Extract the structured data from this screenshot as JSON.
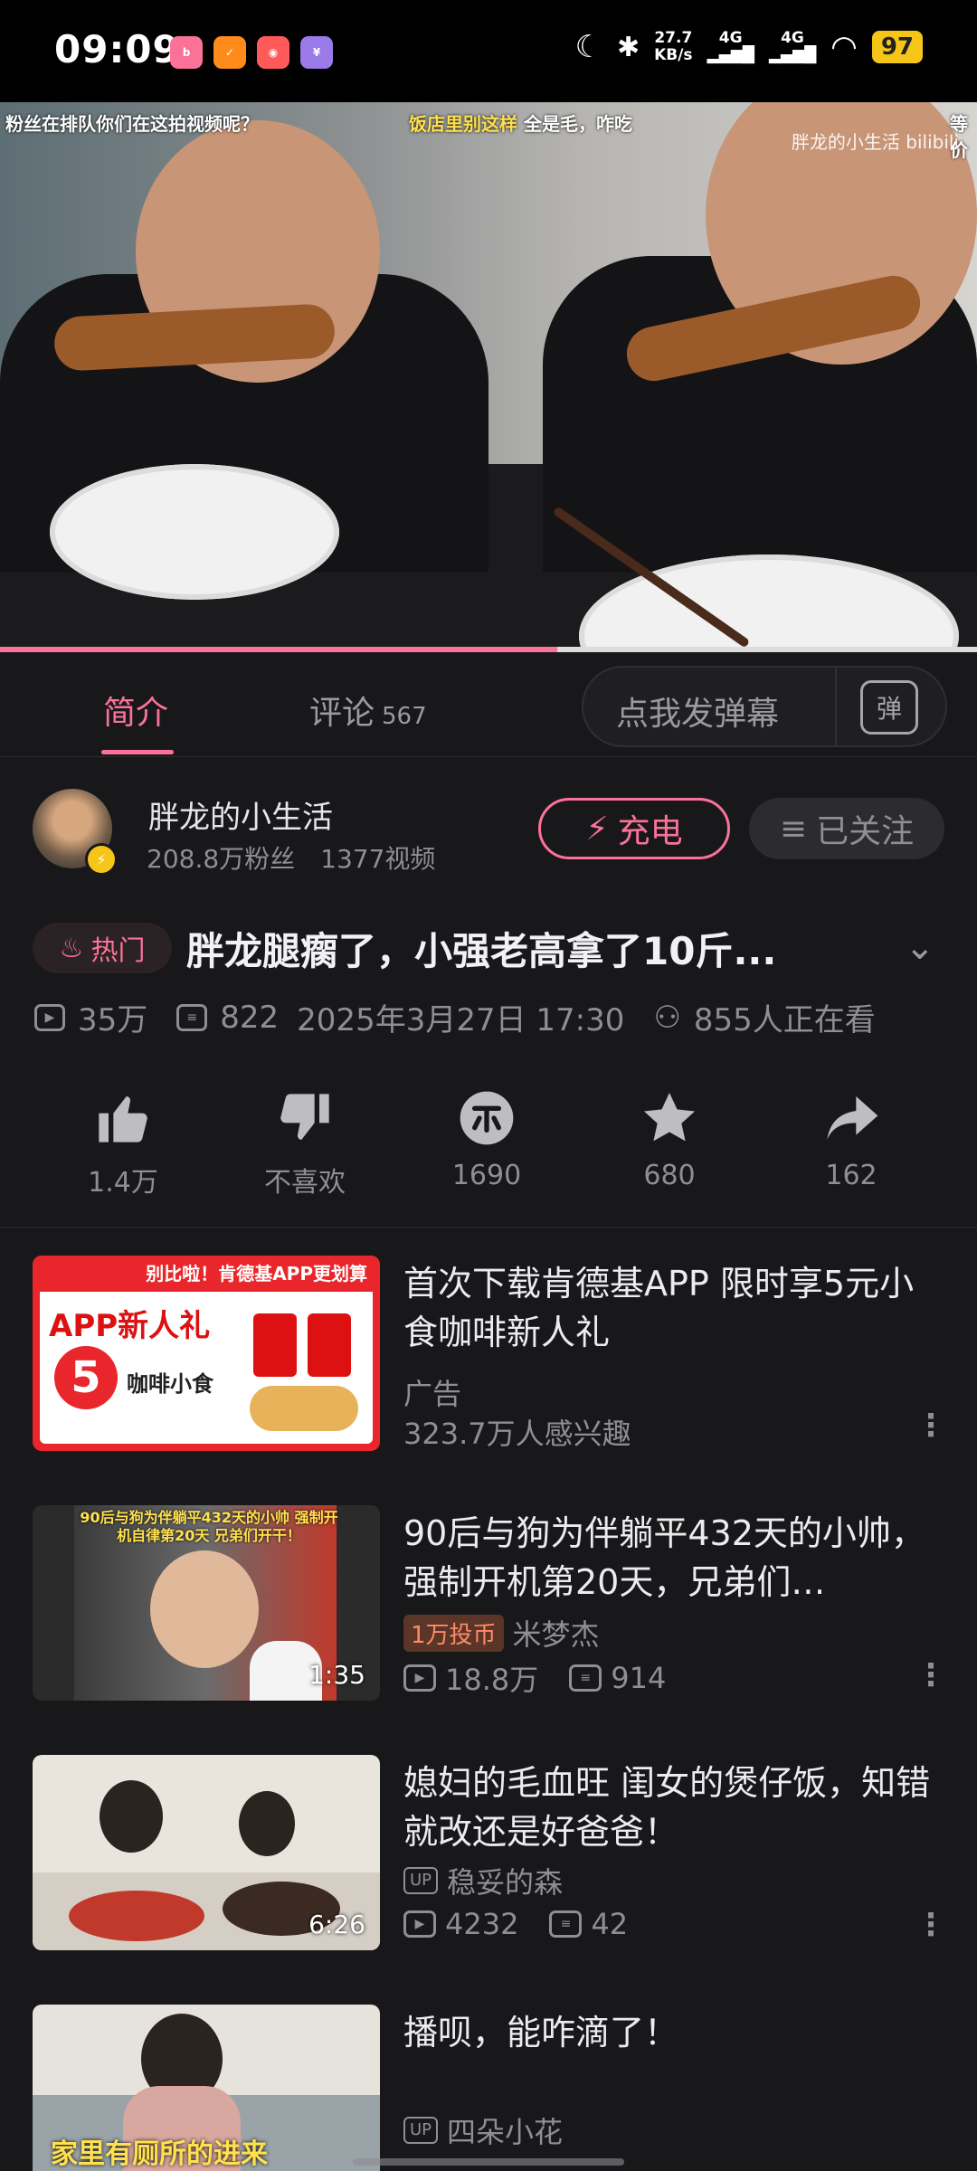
{
  "status_bar": {
    "time": "09:09",
    "net_speed": "27.7",
    "net_unit": "KB/s",
    "sim1": "4G",
    "sim2": "4G",
    "battery": "97"
  },
  "video": {
    "caption_left": "粉丝在排队你们在这拍视频呢？",
    "caption_mid_highlight": "饭店里别这样",
    "caption_mid_rest": "全是毛，咋吃",
    "caption_right": "等价",
    "watermark": "胖龙的小生活 bilibili",
    "progress": 0.57
  },
  "tabs": {
    "intro": "简介",
    "comments": "评论",
    "comments_count": "567",
    "danmu_placeholder": "点我发弹幕",
    "danmu_toggle": "弹"
  },
  "uploader": {
    "name": "胖龙的小生活",
    "fans": "208.8万粉丝",
    "videos": "1377视频",
    "charge_label": "充电",
    "follow_label": "已关注"
  },
  "video_info": {
    "hot_label": "热门",
    "title": "胖龙腿瘸了，小强老高拿了10斤...",
    "views": "35万",
    "danmaku": "822",
    "date": "2025年3月27日 17:30",
    "watching": "855人正在看"
  },
  "actions": {
    "like": "1.4万",
    "dislike": "不喜欢",
    "coin": "1690",
    "favorite": "680",
    "share": "162"
  },
  "feed": [
    {
      "title": "首次下载肯德基APP 限时享5元小食咖啡新人礼",
      "ad_label": "广告",
      "interest": "323.7万人感兴趣",
      "thumb_top": "别比啦！肯德基APP更划算",
      "thumb_main": "APP新人礼",
      "thumb_price": "5",
      "thumb_sub": "咖啡小食"
    },
    {
      "title": "90后与狗为伴躺平432天的小帅，强制开机第20天，兄弟们…",
      "coin_badge": "1万投币",
      "author": "米梦杰",
      "views": "18.8万",
      "danmaku": "914",
      "duration": "1:35",
      "thumb_caption": "90后与狗为伴躺平432天的小帅 强制开机自律第20天 兄弟们开干！"
    },
    {
      "title": "媳妇的毛血旺 闺女的煲仔饭，知错就改还是好爸爸！",
      "up_tag": "UP",
      "author": "稳妥的森",
      "views": "4232",
      "danmaku": "42",
      "duration": "6:26"
    },
    {
      "title": "播呗，能咋滴了！",
      "up_tag": "UP",
      "author": "四朵小花",
      "thumb_caption": "家里有厕所的进来"
    }
  ],
  "colors": {
    "accent": "#fb7299",
    "background": "#18181a",
    "battery": "#f5c518"
  }
}
